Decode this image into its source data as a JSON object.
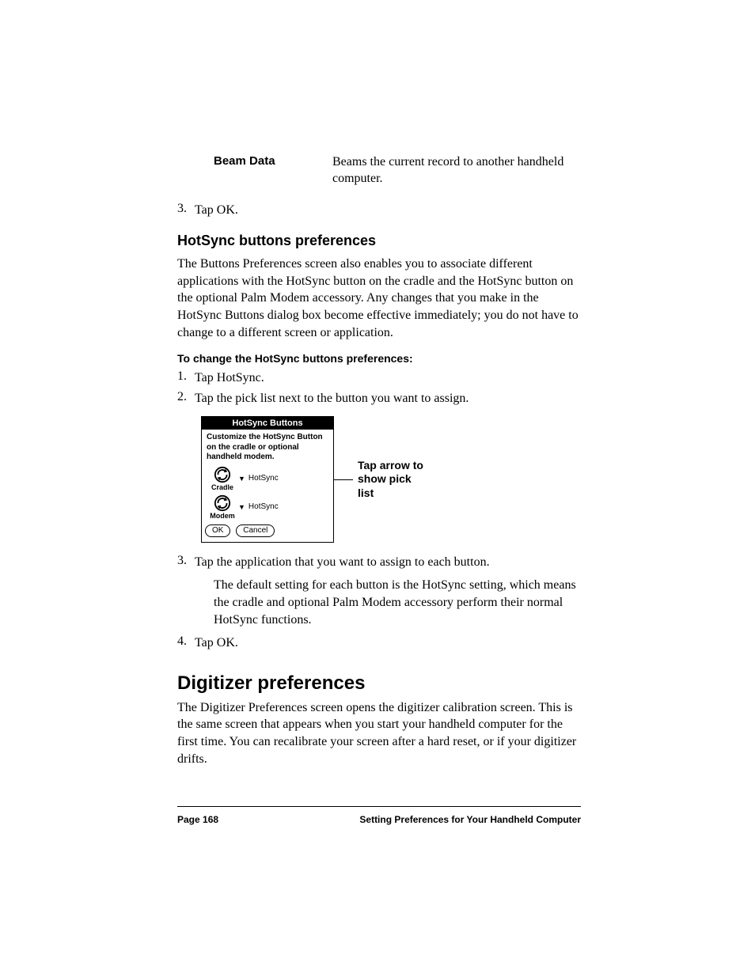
{
  "beam": {
    "term": "Beam Data",
    "desc": "Beams the current record to another handheld computer."
  },
  "step3a": {
    "num": "3.",
    "text": "Tap OK."
  },
  "hotsync_heading": "HotSync buttons preferences",
  "hotsync_para": "The Buttons Preferences screen also enables you to associate different applications with the HotSync button on the cradle and the HotSync button on the optional Palm Modem accessory. Any changes that you make in the HotSync Buttons dialog box become effective immediately; you do not have to change to a different screen or application.",
  "hotsync_subhead": "To change the HotSync buttons preferences:",
  "hs_step1": {
    "num": "1.",
    "text": "Tap HotSync."
  },
  "hs_step2": {
    "num": "2.",
    "text": "Tap the pick list next to the button you want to assign."
  },
  "dialog": {
    "title": "HotSync Buttons",
    "msg": "Customize the HotSync Button on the cradle or optional handheld modem.",
    "row1_label": "Cradle",
    "row1_pick": "HotSync",
    "row2_label": "Modem",
    "row2_pick": "HotSync",
    "ok": "OK",
    "cancel": "Cancel"
  },
  "callout": "Tap arrow to show pick list",
  "hs_step3": {
    "num": "3.",
    "text": "Tap the application that you want to assign to each button."
  },
  "hs_step3_sub": "The default setting for each button is the HotSync setting, which means the cradle and optional Palm Modem accessory perform their normal HotSync functions.",
  "hs_step4": {
    "num": "4.",
    "text": "Tap OK."
  },
  "digitizer_heading": "Digitizer preferences",
  "digitizer_para": "The Digitizer Preferences screen opens the digitizer calibration screen. This is the same screen that appears when you start your handheld computer for the first time.  You can recalibrate your screen after a hard reset, or if your digitizer drifts.",
  "footer": {
    "page": "Page 168",
    "section": "Setting Preferences for Your Handheld Computer"
  }
}
